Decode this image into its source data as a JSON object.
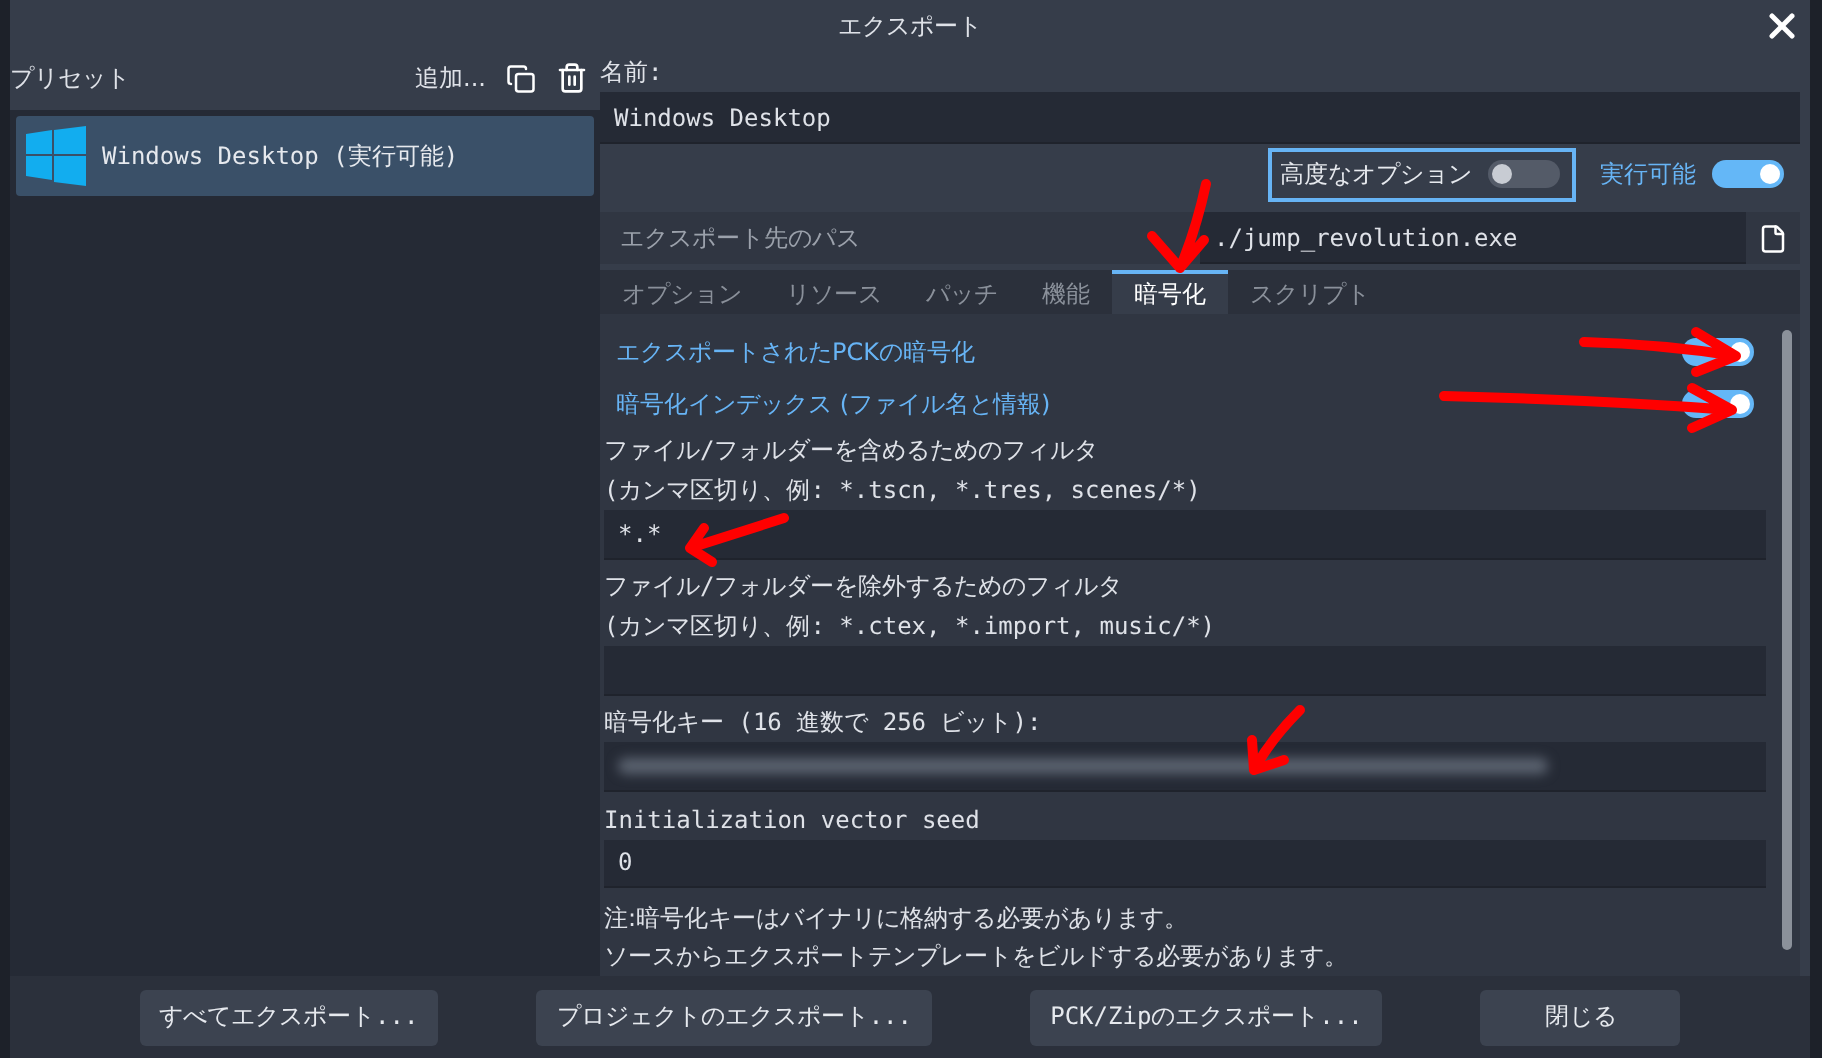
{
  "dialog": {
    "title": "エクスポート"
  },
  "presets": {
    "label": "プリセット",
    "add": "追加...",
    "items": [
      {
        "name": "Windows Desktop (実行可能)",
        "selected": true
      }
    ]
  },
  "name": {
    "label": "名前:",
    "value": "Windows Desktop"
  },
  "options": [
    {
      "label": "高度なオプション",
      "on": false,
      "focused": true
    },
    {
      "label": "実行可能",
      "on": true,
      "focused": false
    }
  ],
  "export_path": {
    "label": "エクスポート先のパス",
    "value": "./jump_revolution.exe"
  },
  "tabs": [
    {
      "label": "オプション",
      "selected": false
    },
    {
      "label": "リソース",
      "selected": false
    },
    {
      "label": "パッチ",
      "selected": false
    },
    {
      "label": "機能",
      "selected": false
    },
    {
      "label": "暗号化",
      "selected": true
    },
    {
      "label": "スクリプト",
      "selected": false
    }
  ],
  "settings": [
    {
      "kind": "toggle",
      "label": "エクスポートされたPCKの暗号化",
      "on": true
    },
    {
      "kind": "toggle",
      "label": "暗号化インデックス (ファイル名と情報)",
      "on": true
    },
    {
      "kind": "text",
      "label": "ファイル/フォルダーを含めるためのフィルタ",
      "hint": "(カンマ区切り、例: *.tscn, *.tres, scenes/*)",
      "value": "*.*"
    },
    {
      "kind": "text",
      "label": "ファイル/フォルダーを除外するためのフィルタ",
      "hint": "(カンマ区切り、例: *.ctex, *.import, music/*)"
    },
    {
      "kind": "secret",
      "label": "暗号化キー (16 進数で 256 ビット):"
    },
    {
      "kind": "text",
      "label": "Initialization vector seed",
      "value": "0"
    },
    {
      "kind": "note",
      "lines": [
        "注:暗号化キーはバイナリに格納する必要があります。",
        "ソースからエクスポートテンプレートをビルドする必要があります。"
      ]
    }
  ],
  "buttons": [
    "すべてエクスポート...",
    "プロジェクトのエクスポート...",
    "PCK/Zipのエクスポート...",
    "閉じる"
  ]
}
